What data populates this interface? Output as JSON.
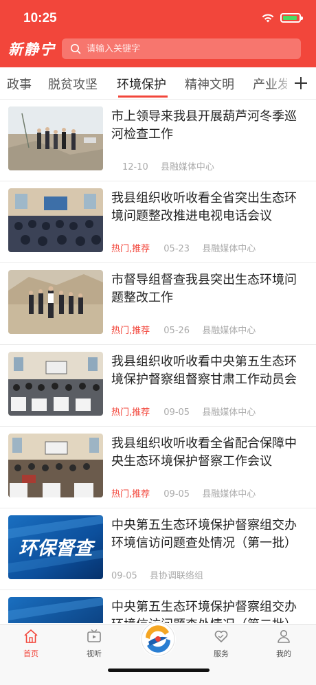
{
  "status": {
    "time": "10:25"
  },
  "header": {
    "logo_text": "新静宁",
    "search_placeholder": "请输入关键字"
  },
  "tabs": [
    {
      "label": "政事",
      "active": false
    },
    {
      "label": "脱贫攻坚",
      "active": false
    },
    {
      "label": "环境保护",
      "active": true
    },
    {
      "label": "精神文明",
      "active": false
    },
    {
      "label": "产业发",
      "active": false
    }
  ],
  "articles": [
    {
      "title": "市上领导来我县开展葫芦河冬季巡河检查工作",
      "tags": "",
      "date": "12-10",
      "source": "县融媒体中心",
      "thumb": "outdoor-river"
    },
    {
      "title": "我县组织收听收看全省突出生态环境问题整改推进电视电话会议",
      "tags": "热门,推荐",
      "date": "05-23",
      "source": "县融媒体中心",
      "thumb": "meeting-hall"
    },
    {
      "title": "市督导组督查我县突出生态环境问题整改工作",
      "tags": "热门,推荐",
      "date": "05-26",
      "source": "县融媒体中心",
      "thumb": "outdoor-hill"
    },
    {
      "title": "我县组织收听收看中央第五生态环境保护督察组督察甘肃工作动员会",
      "tags": "热门,推荐",
      "date": "09-05",
      "source": "县融媒体中心",
      "thumb": "meeting-room"
    },
    {
      "title": "我县组织收听收看全省配合保障中央生态环境保护督察工作会议",
      "tags": "热门,推荐",
      "date": "09-05",
      "source": "县融媒体中心",
      "thumb": "meeting-room-2"
    },
    {
      "title": "中央第五生态环境保护督察组交办环境信访问题查处情况（第一批）",
      "tags": "",
      "date": "09-05",
      "source": "县协调联络组",
      "thumb": "banner-huanbao",
      "thumb_text": "环保督查"
    },
    {
      "title": "中央第五生态环境保护督察组交办环境信访问题查处情况（第二批）",
      "tags": "",
      "date": "",
      "source": "",
      "thumb": "banner-blue"
    }
  ],
  "tabbar": [
    {
      "label": "首页",
      "icon": "home-icon",
      "active": true
    },
    {
      "label": "视听",
      "icon": "tv-icon",
      "active": false
    },
    {
      "label": "",
      "icon": "center-logo",
      "active": false
    },
    {
      "label": "服务",
      "icon": "heart-icon",
      "active": false
    },
    {
      "label": "我的",
      "icon": "user-icon",
      "active": false
    }
  ],
  "colors": {
    "brand": "#f2463b",
    "tag": "#f2463b",
    "meta": "#aaaaaa"
  }
}
